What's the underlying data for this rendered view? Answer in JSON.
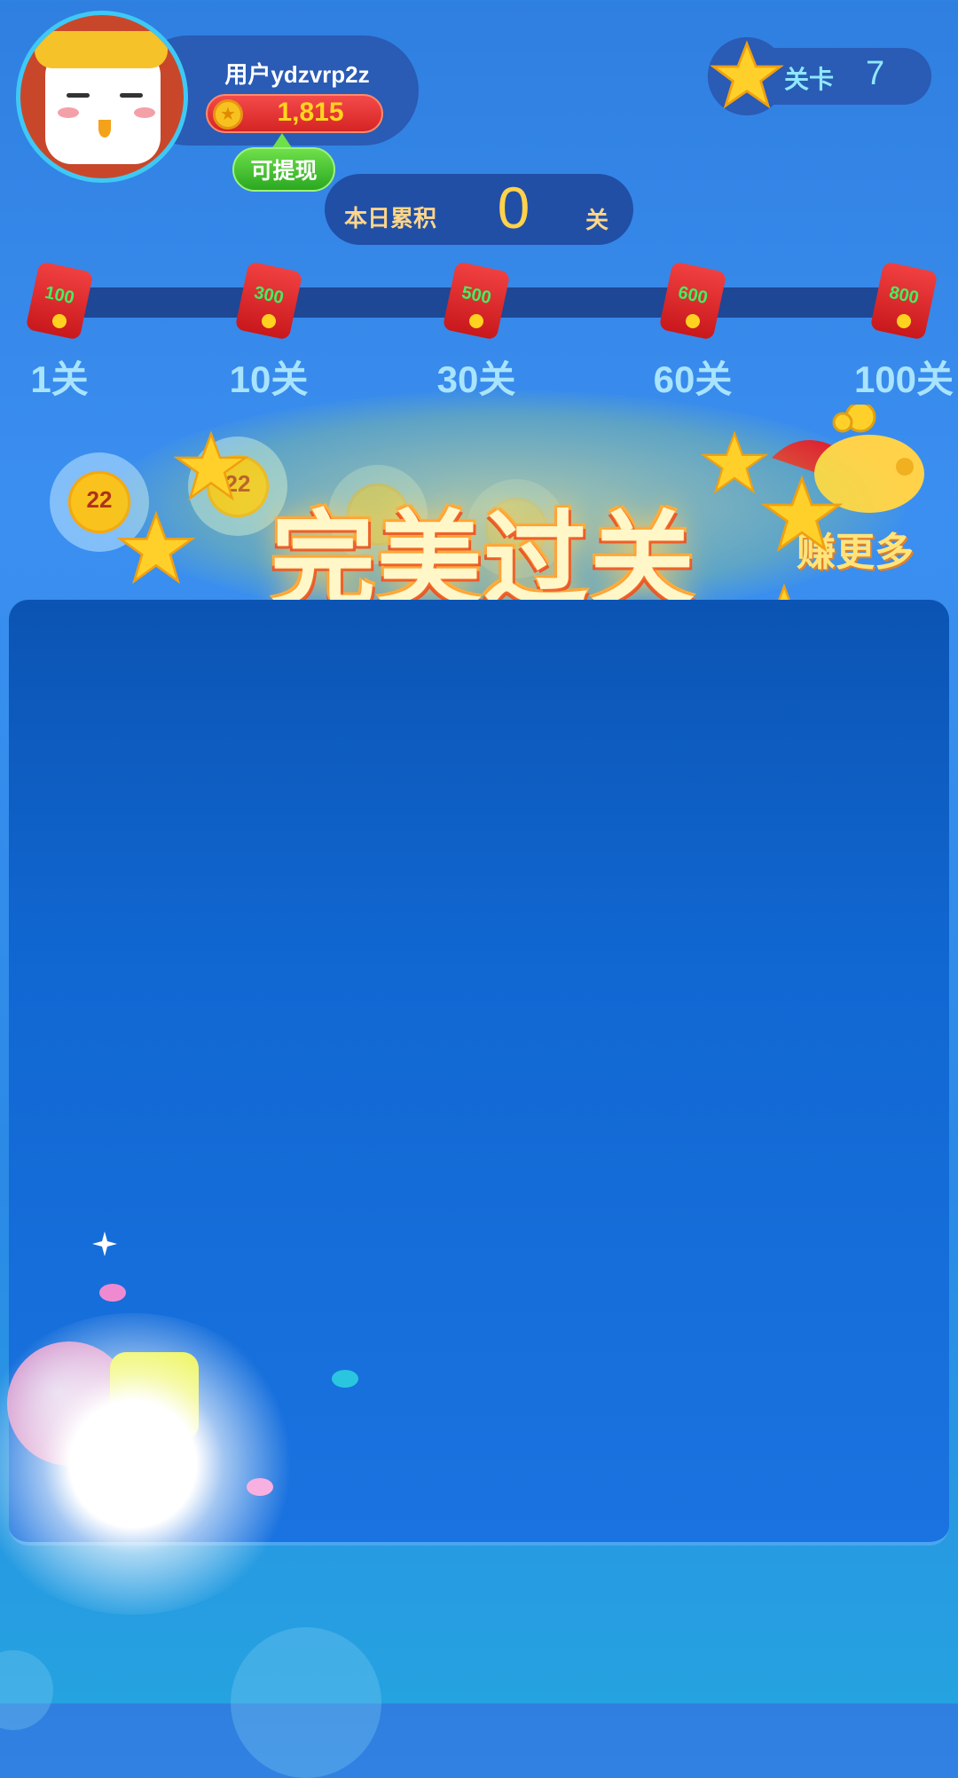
{
  "header": {
    "username": "用户ydzvrp2z",
    "coins": "1,815",
    "withdraw_label": "可提现",
    "level_label": "关卡",
    "level_value": "7"
  },
  "daily": {
    "label": "本日累积",
    "value": "0",
    "unit": "关"
  },
  "milestones": [
    {
      "reward": "100",
      "label": "1关"
    },
    {
      "reward": "300",
      "label": "10关"
    },
    {
      "reward": "500",
      "label": "30关"
    },
    {
      "reward": "600",
      "label": "60关"
    },
    {
      "reward": "800",
      "label": "100关"
    }
  ],
  "bubbles": [
    {
      "value": "22"
    },
    {
      "value": "22"
    }
  ],
  "banner": {
    "title": "完美过关",
    "earn_more": "赚更多"
  },
  "colors": {
    "accent": "#2a5bb5",
    "coin_bar": "#e02f2f",
    "withdraw": "#3cbf2e",
    "board": "#1168d3"
  },
  "icons": [
    "avatar-chicken",
    "coin-icon",
    "star-icon",
    "red-packet-icon",
    "piggy-bank-icon"
  ]
}
